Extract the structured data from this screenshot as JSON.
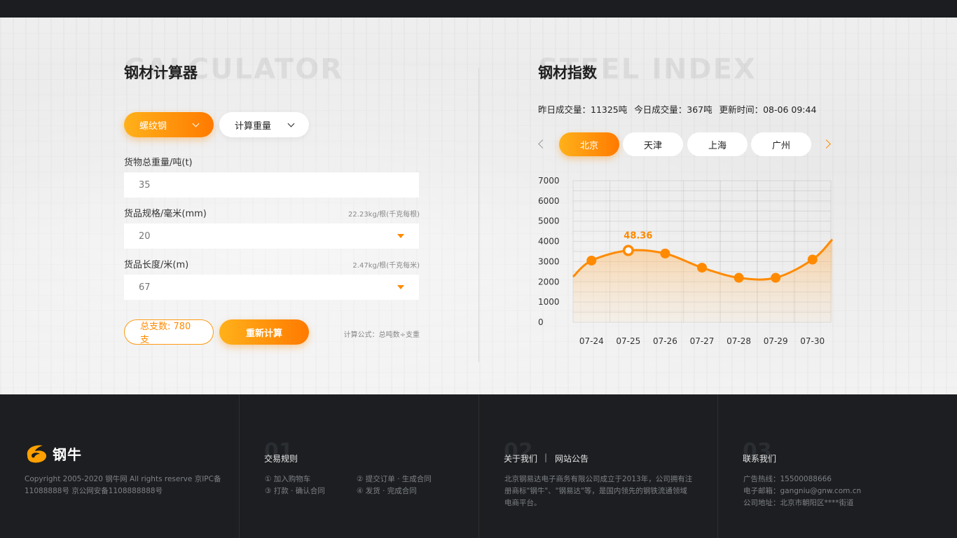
{
  "calculator": {
    "title": "钢材计算器",
    "ghost": "CALCULATOR",
    "type_select": "螺纹钢",
    "mode_select": "计算重量",
    "weight_label": "货物总重量/吨(t)",
    "weight_value": "35",
    "spec_label": "货品规格/毫米(mm)",
    "spec_note": "22.23kg/根(千克每根)",
    "spec_value": "20",
    "length_label": "货品长度/米(m)",
    "length_note": "2.47kg/根(千克每米)",
    "length_value": "67",
    "total_label": "总支数: 780支",
    "recalc_label": "重新计算",
    "formula": "计算公式：总吨数÷支重"
  },
  "index": {
    "title": "钢材指数",
    "ghost": "STEEL INDEX",
    "stats": {
      "yesterday": "昨日成交量：11325吨",
      "today": "今日成交量：367吨",
      "updated": "更新时间：08-06 09:44"
    },
    "cities": [
      "北京",
      "天津",
      "上海",
      "广州"
    ],
    "active_city": "北京"
  },
  "chart_data": {
    "type": "area",
    "categories": [
      "07-24",
      "07-25",
      "07-26",
      "07-27",
      "07-28",
      "07-29",
      "07-30"
    ],
    "values": [
      3050,
      3550,
      3400,
      2700,
      2200,
      2200,
      3100
    ],
    "ylim": [
      0,
      7000
    ],
    "yticks": [
      0,
      1000,
      2000,
      3000,
      4000,
      5000,
      6000,
      7000
    ],
    "highlight_index": 1,
    "highlight_label": "48.36",
    "grid": true,
    "accent": "#ff8a00"
  },
  "footer": {
    "copyright_1": "Copyright 2005-2020  钢牛网 All rights reserve  京IPC备",
    "copyright_2": "11088888号 京公网安备1108888888号",
    "logo_text": "钢牛",
    "col1": {
      "num": "01",
      "title": "交易规则",
      "items": [
        "①  加入购物车",
        "②  提交订单 · 生成合同",
        "③  打款 · 确认合同",
        "④  发货 · 完成合同"
      ]
    },
    "col2": {
      "num": "02",
      "title_a": "关于我们",
      "sep": "|",
      "title_b": "网站公告",
      "text_1": "北京钢易达电子商务有限公司成立于2013年，公司拥有注",
      "text_2": "册商标\"钢牛\"、\"钢易达\"等，是国内领先的钢铁流通领域",
      "text_3": "电商平台。"
    },
    "col3": {
      "num": "03",
      "title": "联系我们",
      "phone": "广告热线：15500088666",
      "email": "电子邮箱：gangniu@gnw.com.cn",
      "address": "公司地址：北京市朝阳区****街道"
    }
  }
}
